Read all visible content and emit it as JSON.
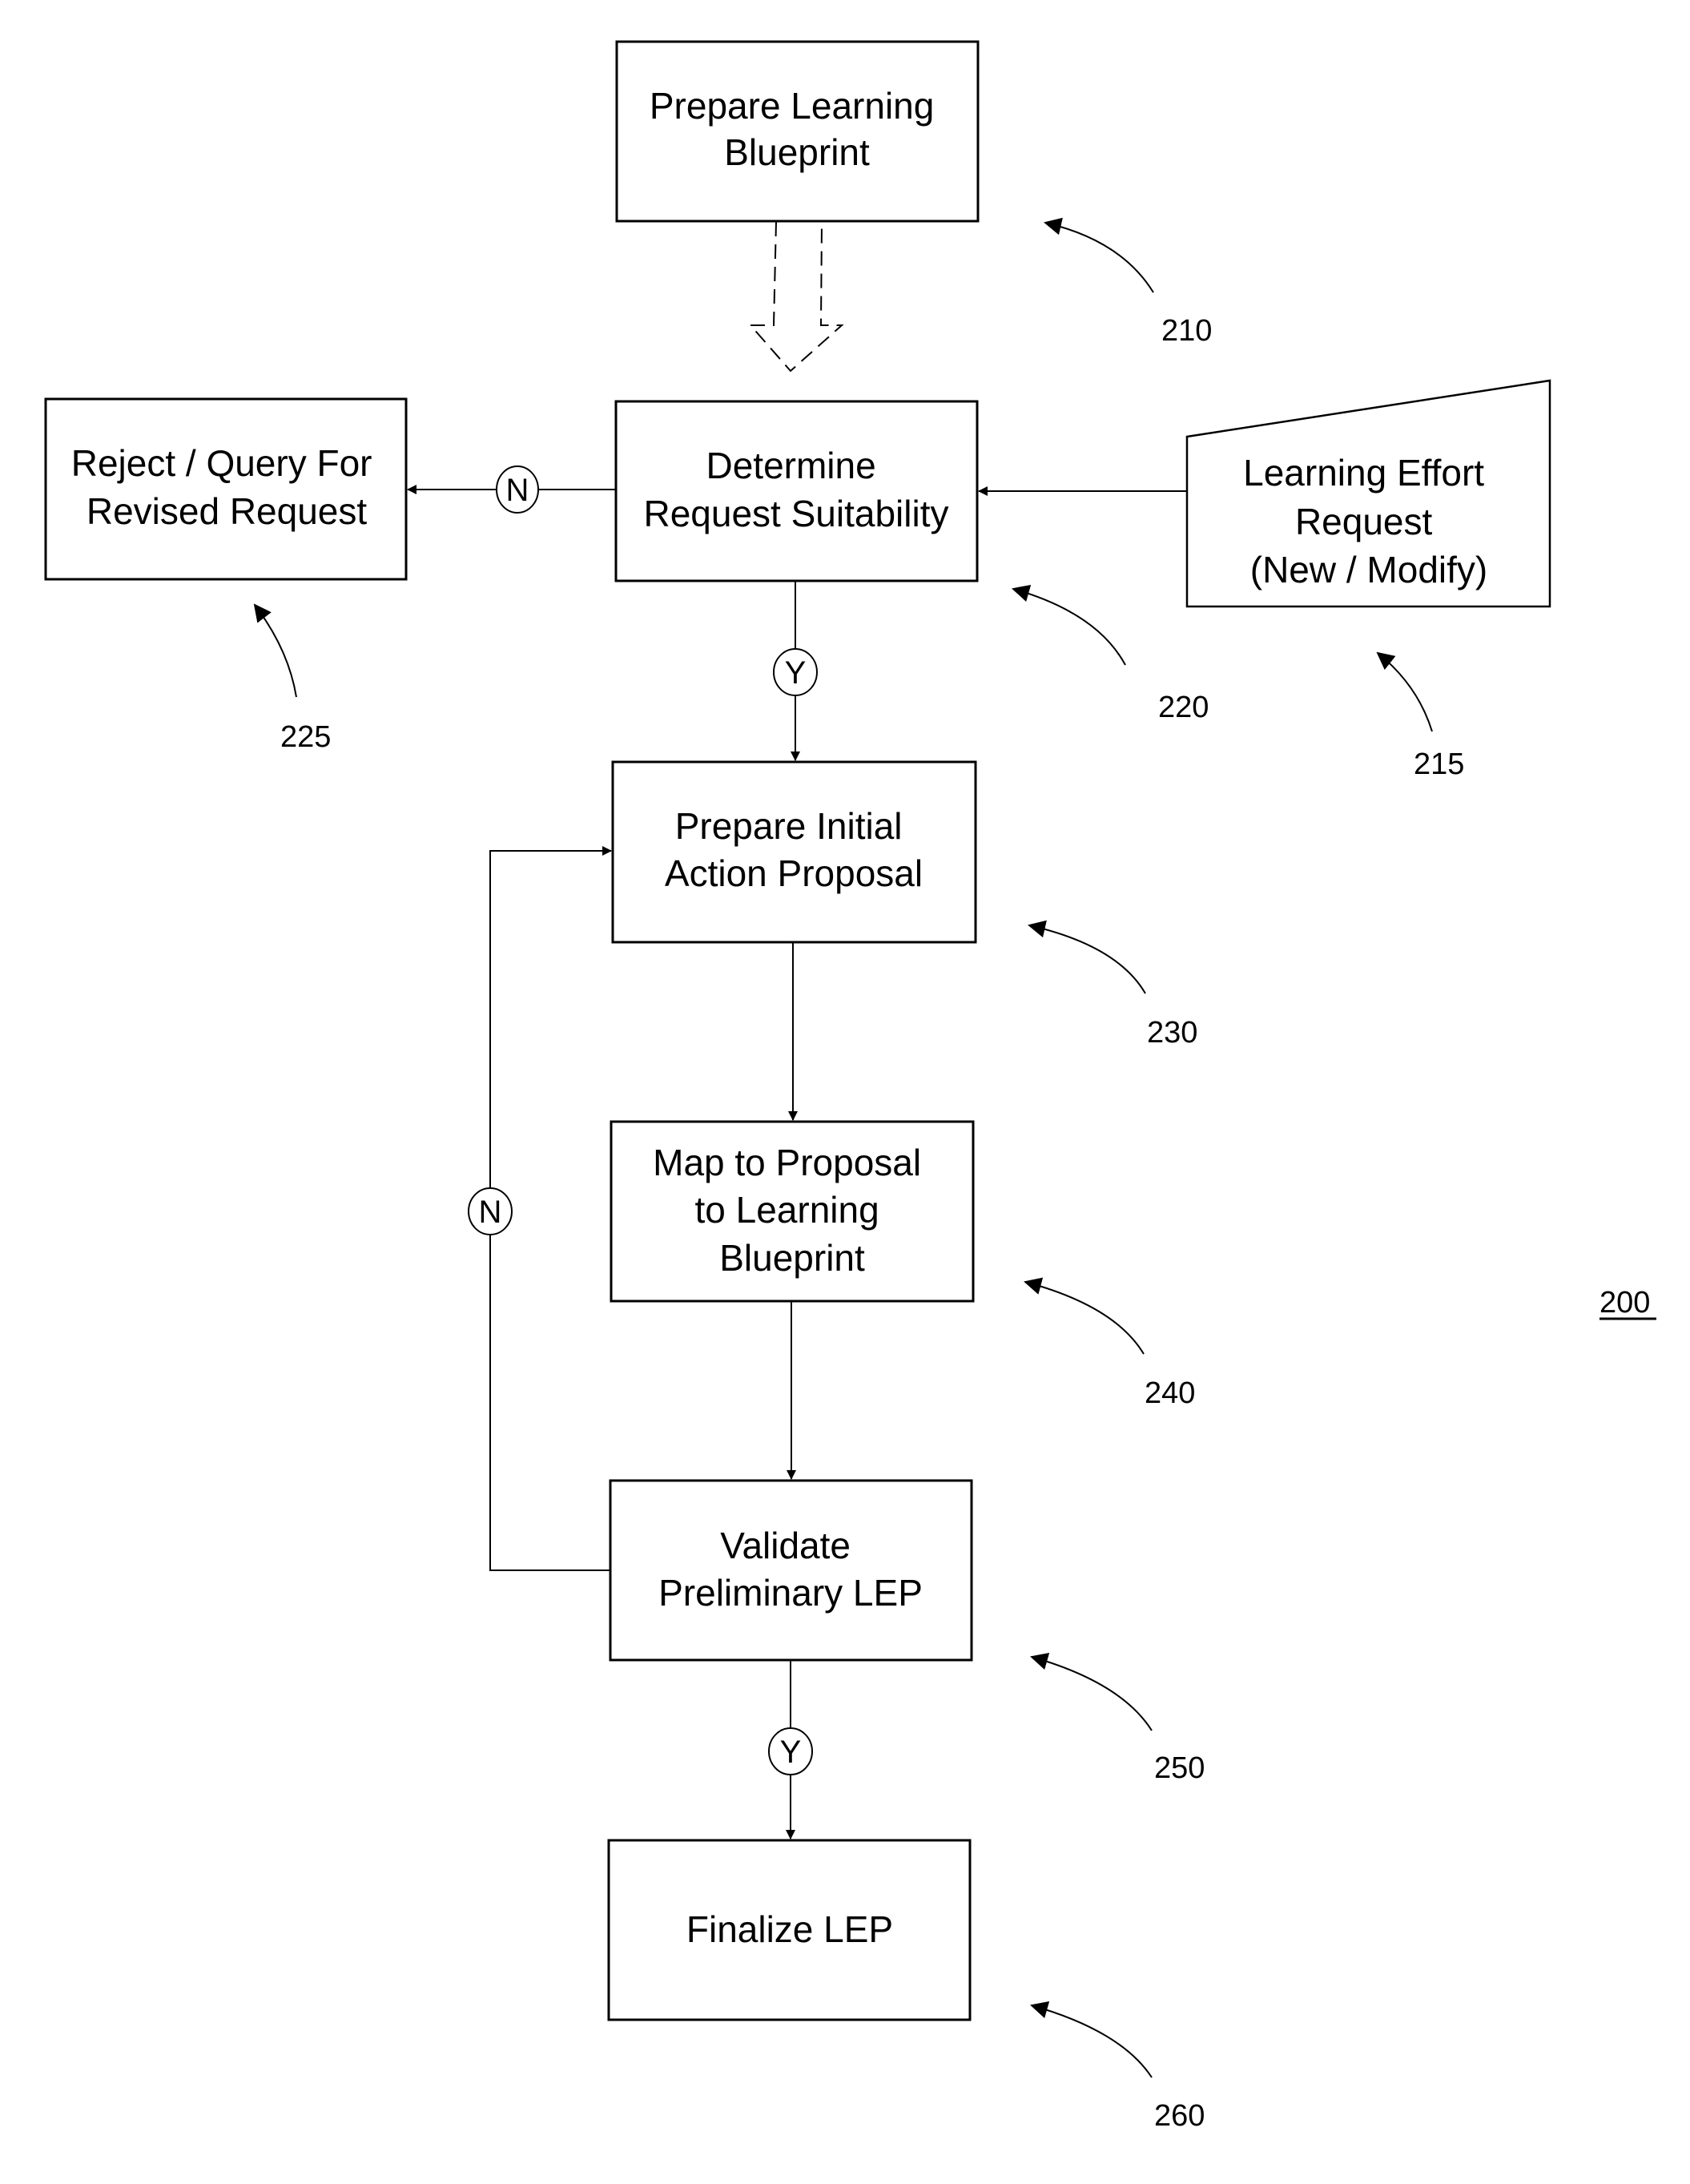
{
  "figure": {
    "number": "200",
    "colors": {
      "stroke": "#000000",
      "background": "#ffffff"
    }
  },
  "steps": [
    {
      "id": "210",
      "ref": "210",
      "shape": "process",
      "lines": [
        "Prepare Learning",
        "Blueprint"
      ]
    },
    {
      "id": "215",
      "ref": "215",
      "shape": "manual-input",
      "lines": [
        "Learning Effort",
        "Request",
        "(New / Modify)"
      ]
    },
    {
      "id": "220",
      "ref": "220",
      "shape": "process",
      "lines": [
        "Determine",
        "Request Suitability"
      ]
    },
    {
      "id": "225",
      "ref": "225",
      "shape": "process",
      "lines": [
        "Reject / Query For",
        "Revised Request"
      ]
    },
    {
      "id": "230",
      "ref": "230",
      "shape": "process",
      "lines": [
        "Prepare Initial",
        "Action Proposal"
      ]
    },
    {
      "id": "240",
      "ref": "240",
      "shape": "process",
      "lines": [
        "Map to Proposal",
        "to Learning",
        "Blueprint"
      ]
    },
    {
      "id": "250",
      "ref": "250",
      "shape": "process",
      "lines": [
        "Validate",
        "Preliminary LEP"
      ]
    },
    {
      "id": "260",
      "ref": "260",
      "shape": "process",
      "lines": [
        "Finalize LEP"
      ]
    }
  ],
  "connectors": [
    {
      "from": "210",
      "to": "220",
      "style": "dashed-block-arrow",
      "label": ""
    },
    {
      "from": "215",
      "to": "220",
      "style": "solid",
      "label": ""
    },
    {
      "from": "220",
      "to": "225",
      "style": "solid",
      "label": "N"
    },
    {
      "from": "220",
      "to": "230",
      "style": "solid",
      "label": "Y"
    },
    {
      "from": "230",
      "to": "240",
      "style": "solid",
      "label": ""
    },
    {
      "from": "240",
      "to": "250",
      "style": "solid",
      "label": ""
    },
    {
      "from": "250",
      "to": "230",
      "style": "solid-loop",
      "label": "N"
    },
    {
      "from": "250",
      "to": "260",
      "style": "solid",
      "label": "Y"
    }
  ]
}
